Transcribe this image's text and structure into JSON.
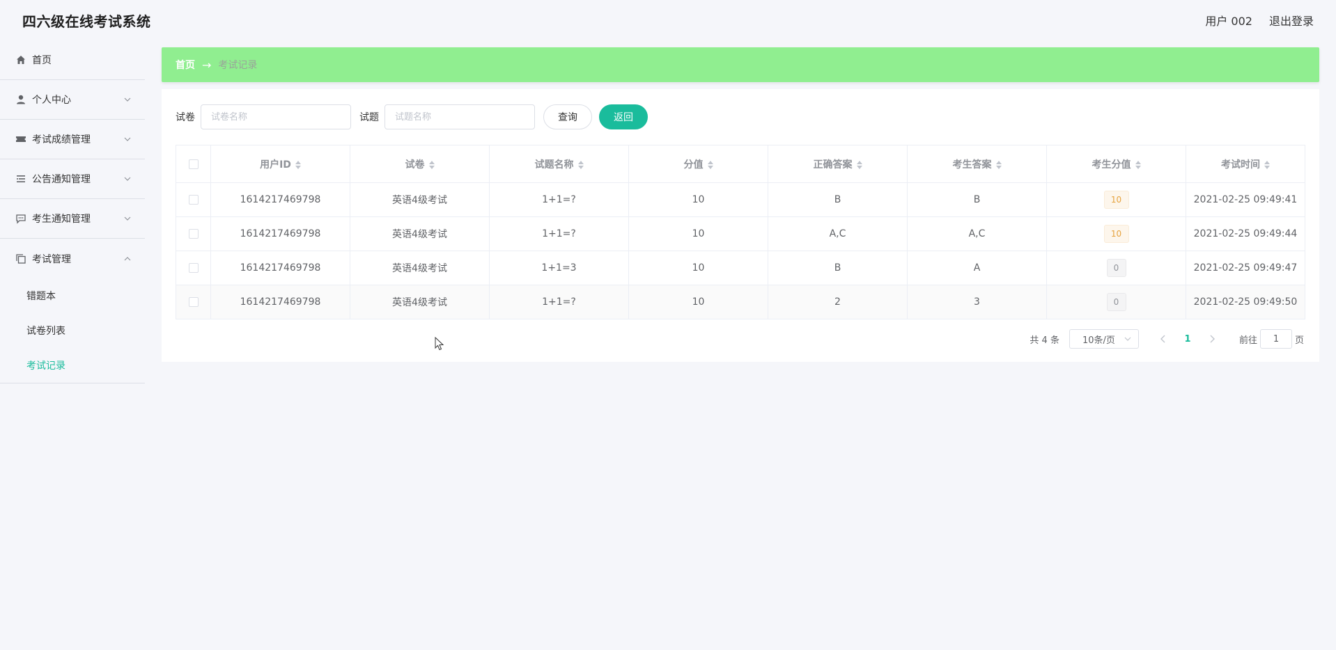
{
  "header": {
    "title": "四六级在线考试系统",
    "user": "用户 002",
    "logout": "退出登录"
  },
  "sidebar": {
    "items": [
      {
        "label": "首页",
        "icon": "home-icon"
      },
      {
        "label": "个人中心",
        "icon": "user-icon"
      },
      {
        "label": "考试成绩管理",
        "icon": "ticket-icon"
      },
      {
        "label": "公告通知管理",
        "icon": "list-icon"
      },
      {
        "label": "考生通知管理",
        "icon": "message-icon"
      },
      {
        "label": "考试管理",
        "icon": "copy-icon"
      }
    ],
    "submenu": [
      {
        "label": "错题本"
      },
      {
        "label": "试卷列表"
      },
      {
        "label": "考试记录"
      }
    ]
  },
  "breadcrumb": {
    "home": "首页",
    "arrow": "→",
    "current": "考试记录"
  },
  "search": {
    "paper_label": "试卷",
    "paper_placeholder": "试卷名称",
    "question_label": "试题",
    "question_placeholder": "试题名称",
    "query_button": "查询",
    "back_button": "返回"
  },
  "table": {
    "columns": [
      "用户ID",
      "试卷",
      "试题名称",
      "分值",
      "正确答案",
      "考生答案",
      "考生分值",
      "考试时间"
    ],
    "rows": [
      {
        "user_id": "1614217469798",
        "paper": "英语4级考试",
        "question": "1+1=?",
        "value": "10",
        "correct": "B",
        "answer": "B",
        "score": "10",
        "time": "2021-02-25 09:49:41"
      },
      {
        "user_id": "1614217469798",
        "paper": "英语4级考试",
        "question": "1+1=?",
        "value": "10",
        "correct": "A,C",
        "answer": "A,C",
        "score": "10",
        "time": "2021-02-25 09:49:44"
      },
      {
        "user_id": "1614217469798",
        "paper": "英语4级考试",
        "question": "1+1=3",
        "value": "10",
        "correct": "B",
        "answer": "A",
        "score": "0",
        "time": "2021-02-25 09:49:47"
      },
      {
        "user_id": "1614217469798",
        "paper": "英语4级考试",
        "question": "1+1=?",
        "value": "10",
        "correct": "2",
        "answer": "3",
        "score": "0",
        "time": "2021-02-25 09:49:50"
      }
    ]
  },
  "pagination": {
    "total": "共 4 条",
    "page_size": "10条/页",
    "current_page": "1",
    "goto_label": "前往",
    "goto_value": "1",
    "page_suffix": "页"
  },
  "colors": {
    "accent": "#1abc9c",
    "breadcrumb_bg": "#90ee90"
  }
}
